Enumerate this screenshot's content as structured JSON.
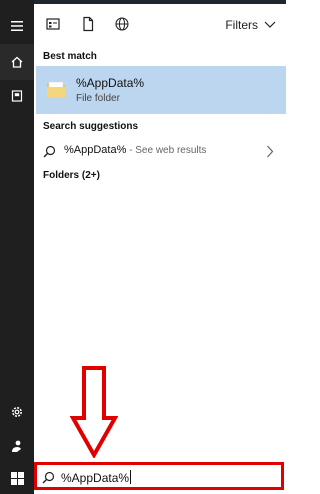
{
  "rail": {
    "icons": [
      "hamburger-icon",
      "home-icon",
      "notebook-icon",
      "settings-icon",
      "user-icon",
      "windows-logo-icon"
    ]
  },
  "topbar": {
    "filters_label": "Filters"
  },
  "results": {
    "best_match_heading": "Best match",
    "best_match": {
      "title": "%AppData%",
      "subtitle": "File folder"
    },
    "suggestions_heading": "Search suggestions",
    "suggestion": {
      "query": "%AppData%",
      "suffix": " - See web results"
    },
    "folders_heading": "Folders (2+)"
  },
  "searchbox": {
    "value": "%AppData%"
  },
  "colors": {
    "rail_bg": "#1f1f1f",
    "selection_bg": "#bcd6ef",
    "annotation_red": "#e00000"
  }
}
